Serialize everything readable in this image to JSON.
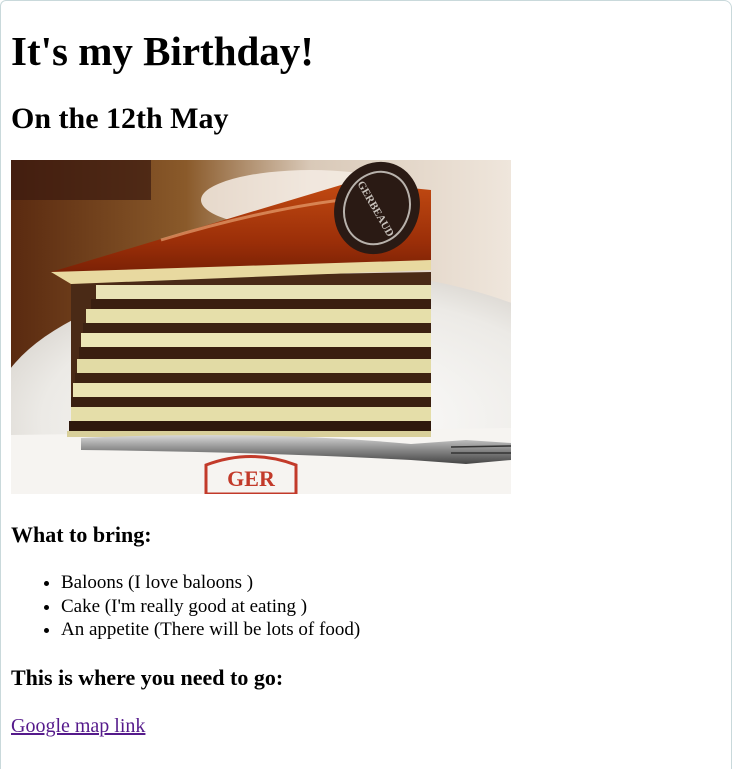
{
  "page": {
    "title": "It's my Birthday!",
    "subtitle": "On the 12th May"
  },
  "image": {
    "alt": "Layered chocolate cake slice",
    "seal_text": "GERBEAUD",
    "napkin_text": "GER"
  },
  "bring": {
    "heading": "What to bring:",
    "items": [
      "Baloons (I love baloons )",
      "Cake (I'm really good at eating )",
      "An appetite (There will be lots of food)"
    ]
  },
  "directions": {
    "heading": "This is where you need to go:",
    "link_label": "Google map link"
  },
  "colors": {
    "link_visited": "#551a8b",
    "frame_border": "#c9d9db"
  }
}
